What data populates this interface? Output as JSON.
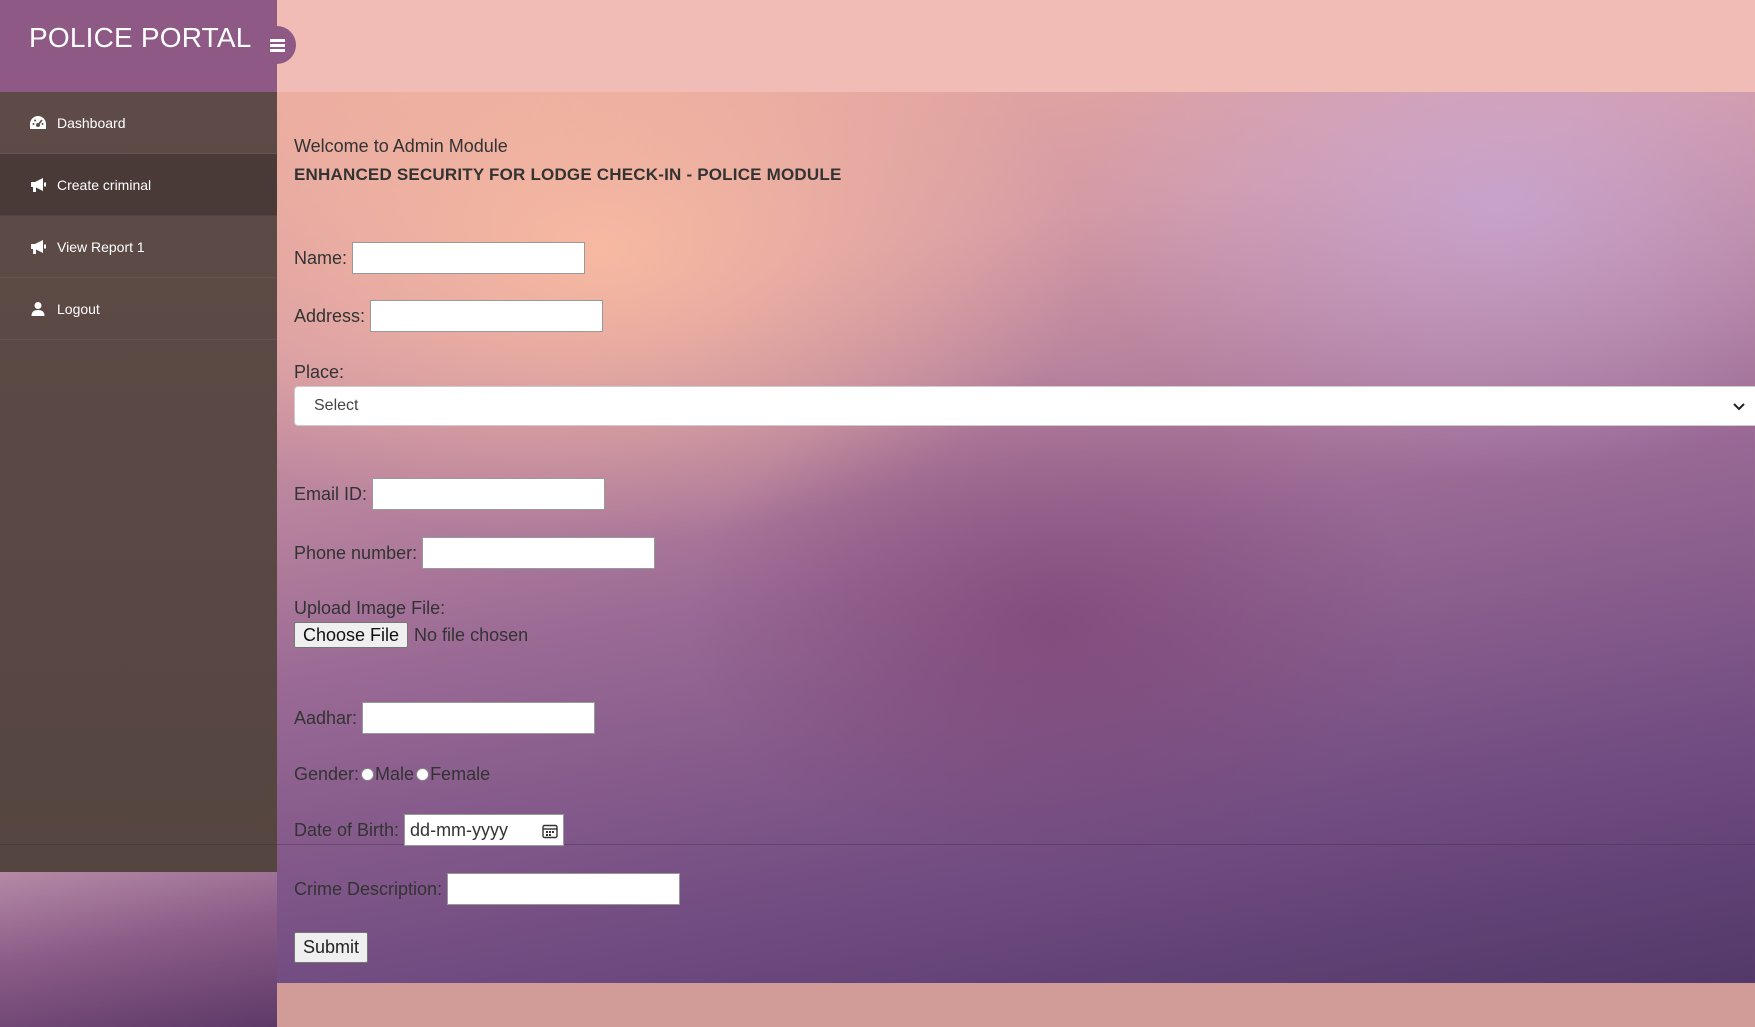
{
  "app": {
    "title": "POLICE PORTAL"
  },
  "sidebar": {
    "items": [
      {
        "label": "Dashboard",
        "icon": "dashboard-icon"
      },
      {
        "label": "Create criminal",
        "icon": "bullhorn-icon"
      },
      {
        "label": "View Report 1",
        "icon": "bullhorn-icon"
      },
      {
        "label": "Logout",
        "icon": "user-icon"
      }
    ],
    "active_item": "Create criminal"
  },
  "main": {
    "welcome": "Welcome to Admin Module",
    "module_title": "ENHANCED SECURITY FOR LODGE CHECK-IN - POLICE MODULE"
  },
  "form": {
    "name_label": "Name:",
    "name_value": "",
    "address_label": "Address:",
    "address_value": "",
    "place_label": "Place:",
    "place_selected": "Select",
    "email_label": "Email ID:",
    "email_value": "",
    "phone_label": "Phone number:",
    "phone_value": "",
    "upload_label": "Upload Image File:",
    "choose_file": "Choose File",
    "file_status": "No file chosen",
    "aadhar_label": "Aadhar:",
    "aadhar_value": "",
    "gender_label": "Gender:",
    "gender_male": "Male",
    "gender_female": "Female",
    "dob_label": "Date of Birth:",
    "dob_placeholder": "dd-mm-yyyy",
    "crime_label": "Crime Description:",
    "crime_value": "",
    "submit_label": "Submit"
  },
  "colors": {
    "brand_bg": "#8e5a85",
    "sidebar_bg": "#5e4b47",
    "topbar_bg": "#f1bbb6",
    "footer_bg": "#d19b97"
  }
}
